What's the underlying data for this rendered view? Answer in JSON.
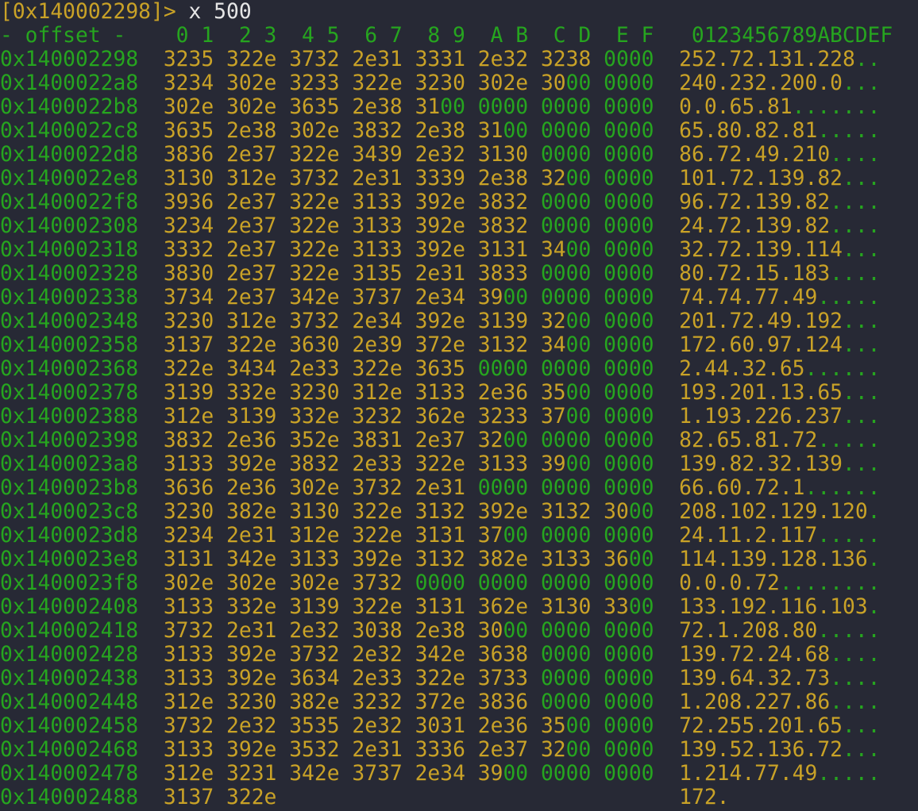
{
  "prompt": {
    "address": "[0x140002298]>",
    "command": "x 500"
  },
  "colors": {
    "background": "#272935",
    "printable": "#c9a227",
    "nonprintable": "#26a51f",
    "command": "#e6e6e6"
  },
  "header": {
    "offset_label": "- offset -",
    "columns": [
      "0 1",
      "2 3",
      "4 5",
      "6 7",
      "8 9",
      "A B",
      "C D",
      "E F"
    ],
    "ascii_label": "0123456789ABCDEF"
  },
  "rows": [
    {
      "offset": "0x140002298",
      "words": [
        "3235",
        "322e",
        "3732",
        "2e31",
        "3331",
        "2e32",
        "3238",
        "0000"
      ],
      "ascii": "252.72.131.228.."
    },
    {
      "offset": "0x1400022a8",
      "words": [
        "3234",
        "302e",
        "3233",
        "322e",
        "3230",
        "302e",
        "3000",
        "0000"
      ],
      "ascii": "240.232.200.0..."
    },
    {
      "offset": "0x1400022b8",
      "words": [
        "302e",
        "302e",
        "3635",
        "2e38",
        "3100",
        "0000",
        "0000",
        "0000"
      ],
      "ascii": "0.0.65.81......."
    },
    {
      "offset": "0x1400022c8",
      "words": [
        "3635",
        "2e38",
        "302e",
        "3832",
        "2e38",
        "3100",
        "0000",
        "0000"
      ],
      "ascii": "65.80.82.81....."
    },
    {
      "offset": "0x1400022d8",
      "words": [
        "3836",
        "2e37",
        "322e",
        "3439",
        "2e32",
        "3130",
        "0000",
        "0000"
      ],
      "ascii": "86.72.49.210...."
    },
    {
      "offset": "0x1400022e8",
      "words": [
        "3130",
        "312e",
        "3732",
        "2e31",
        "3339",
        "2e38",
        "3200",
        "0000"
      ],
      "ascii": "101.72.139.82..."
    },
    {
      "offset": "0x1400022f8",
      "words": [
        "3936",
        "2e37",
        "322e",
        "3133",
        "392e",
        "3832",
        "0000",
        "0000"
      ],
      "ascii": "96.72.139.82...."
    },
    {
      "offset": "0x140002308",
      "words": [
        "3234",
        "2e37",
        "322e",
        "3133",
        "392e",
        "3832",
        "0000",
        "0000"
      ],
      "ascii": "24.72.139.82...."
    },
    {
      "offset": "0x140002318",
      "words": [
        "3332",
        "2e37",
        "322e",
        "3133",
        "392e",
        "3131",
        "3400",
        "0000"
      ],
      "ascii": "32.72.139.114..."
    },
    {
      "offset": "0x140002328",
      "words": [
        "3830",
        "2e37",
        "322e",
        "3135",
        "2e31",
        "3833",
        "0000",
        "0000"
      ],
      "ascii": "80.72.15.183...."
    },
    {
      "offset": "0x140002338",
      "words": [
        "3734",
        "2e37",
        "342e",
        "3737",
        "2e34",
        "3900",
        "0000",
        "0000"
      ],
      "ascii": "74.74.77.49....."
    },
    {
      "offset": "0x140002348",
      "words": [
        "3230",
        "312e",
        "3732",
        "2e34",
        "392e",
        "3139",
        "3200",
        "0000"
      ],
      "ascii": "201.72.49.192..."
    },
    {
      "offset": "0x140002358",
      "words": [
        "3137",
        "322e",
        "3630",
        "2e39",
        "372e",
        "3132",
        "3400",
        "0000"
      ],
      "ascii": "172.60.97.124..."
    },
    {
      "offset": "0x140002368",
      "words": [
        "322e",
        "3434",
        "2e33",
        "322e",
        "3635",
        "0000",
        "0000",
        "0000"
      ],
      "ascii": "2.44.32.65......"
    },
    {
      "offset": "0x140002378",
      "words": [
        "3139",
        "332e",
        "3230",
        "312e",
        "3133",
        "2e36",
        "3500",
        "0000"
      ],
      "ascii": "193.201.13.65..."
    },
    {
      "offset": "0x140002388",
      "words": [
        "312e",
        "3139",
        "332e",
        "3232",
        "362e",
        "3233",
        "3700",
        "0000"
      ],
      "ascii": "1.193.226.237..."
    },
    {
      "offset": "0x140002398",
      "words": [
        "3832",
        "2e36",
        "352e",
        "3831",
        "2e37",
        "3200",
        "0000",
        "0000"
      ],
      "ascii": "82.65.81.72....."
    },
    {
      "offset": "0x1400023a8",
      "words": [
        "3133",
        "392e",
        "3832",
        "2e33",
        "322e",
        "3133",
        "3900",
        "0000"
      ],
      "ascii": "139.82.32.139..."
    },
    {
      "offset": "0x1400023b8",
      "words": [
        "3636",
        "2e36",
        "302e",
        "3732",
        "2e31",
        "0000",
        "0000",
        "0000"
      ],
      "ascii": "66.60.72.1......"
    },
    {
      "offset": "0x1400023c8",
      "words": [
        "3230",
        "382e",
        "3130",
        "322e",
        "3132",
        "392e",
        "3132",
        "3000"
      ],
      "ascii": "208.102.129.120."
    },
    {
      "offset": "0x1400023d8",
      "words": [
        "3234",
        "2e31",
        "312e",
        "322e",
        "3131",
        "3700",
        "0000",
        "0000"
      ],
      "ascii": "24.11.2.117....."
    },
    {
      "offset": "0x1400023e8",
      "words": [
        "3131",
        "342e",
        "3133",
        "392e",
        "3132",
        "382e",
        "3133",
        "3600"
      ],
      "ascii": "114.139.128.136."
    },
    {
      "offset": "0x1400023f8",
      "words": [
        "302e",
        "302e",
        "302e",
        "3732",
        "0000",
        "0000",
        "0000",
        "0000"
      ],
      "ascii": "0.0.0.72........"
    },
    {
      "offset": "0x140002408",
      "words": [
        "3133",
        "332e",
        "3139",
        "322e",
        "3131",
        "362e",
        "3130",
        "3300"
      ],
      "ascii": "133.192.116.103."
    },
    {
      "offset": "0x140002418",
      "words": [
        "3732",
        "2e31",
        "2e32",
        "3038",
        "2e38",
        "3000",
        "0000",
        "0000"
      ],
      "ascii": "72.1.208.80....."
    },
    {
      "offset": "0x140002428",
      "words": [
        "3133",
        "392e",
        "3732",
        "2e32",
        "342e",
        "3638",
        "0000",
        "0000"
      ],
      "ascii": "139.72.24.68...."
    },
    {
      "offset": "0x140002438",
      "words": [
        "3133",
        "392e",
        "3634",
        "2e33",
        "322e",
        "3733",
        "0000",
        "0000"
      ],
      "ascii": "139.64.32.73...."
    },
    {
      "offset": "0x140002448",
      "words": [
        "312e",
        "3230",
        "382e",
        "3232",
        "372e",
        "3836",
        "0000",
        "0000"
      ],
      "ascii": "1.208.227.86...."
    },
    {
      "offset": "0x140002458",
      "words": [
        "3732",
        "2e32",
        "3535",
        "2e32",
        "3031",
        "2e36",
        "3500",
        "0000"
      ],
      "ascii": "72.255.201.65..."
    },
    {
      "offset": "0x140002468",
      "words": [
        "3133",
        "392e",
        "3532",
        "2e31",
        "3336",
        "2e37",
        "3200",
        "0000"
      ],
      "ascii": "139.52.136.72..."
    },
    {
      "offset": "0x140002478",
      "words": [
        "312e",
        "3231",
        "342e",
        "3737",
        "2e34",
        "3900",
        "0000",
        "0000"
      ],
      "ascii": "1.214.77.49....."
    },
    {
      "offset": "0x140002488",
      "words": [
        "3137",
        "322e"
      ],
      "ascii": "172."
    }
  ]
}
